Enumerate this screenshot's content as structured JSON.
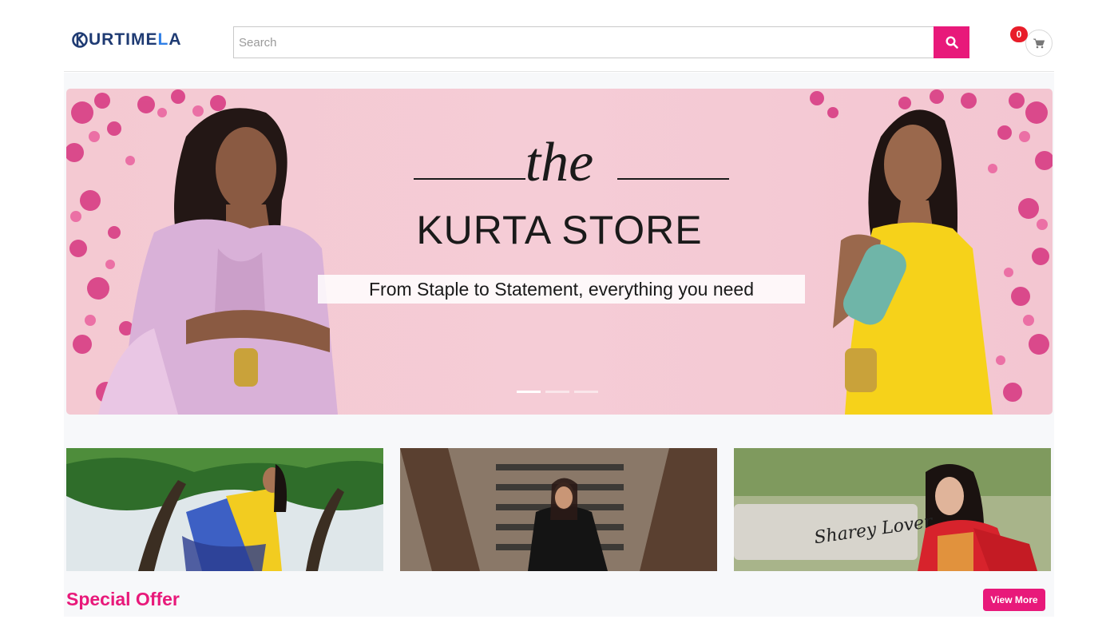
{
  "header": {
    "logo": {
      "part1": "URTI ",
      "part2": "ME",
      "part3": "L",
      "part4": "A"
    },
    "search": {
      "placeholder": "Search",
      "value": ""
    },
    "cart": {
      "count": "0"
    }
  },
  "banner": {
    "the_text": "the",
    "title": "KURTA STORE",
    "subtitle": "From Staple to Statement, everything you need",
    "slides": 3,
    "active_slide": 1
  },
  "tiles": [
    {
      "image": "woman-yellow-blue-saree-under-tree"
    },
    {
      "image": "woman-black-saree-on-staircase"
    },
    {
      "image": "woman-red-saree-outdoors",
      "signature": "Sharey Lover"
    }
  ],
  "special_offer": {
    "title": "Special Offer",
    "view_more_label": "View More"
  },
  "colors": {
    "accent": "#e8197a",
    "badge": "#e81d2a",
    "logo_navy": "#1f3b73",
    "banner_bg": "#f5ccd6"
  }
}
